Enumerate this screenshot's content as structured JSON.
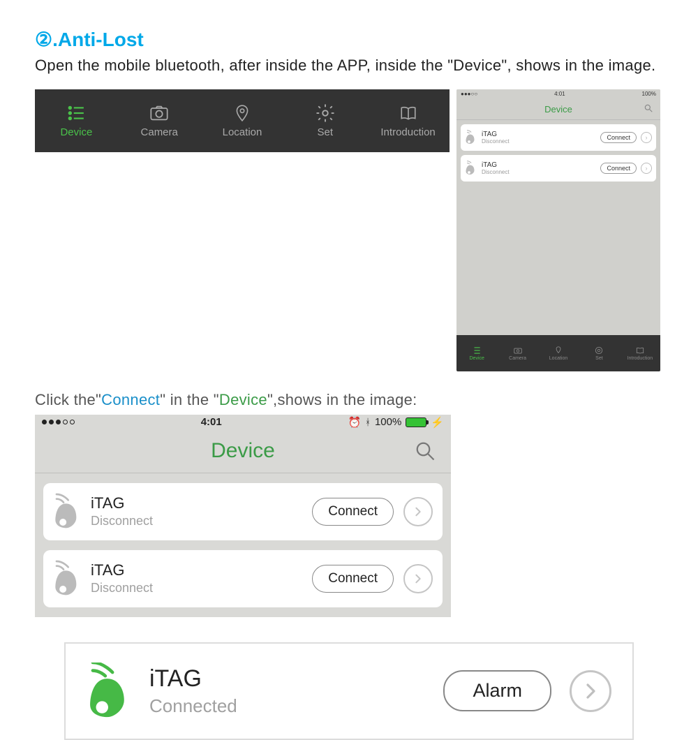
{
  "heading": "②.Anti-Lost",
  "body": "Open the mobile bluetooth, after inside the APP, inside the \"Device\", shows in the image.",
  "toolbar": {
    "items": [
      {
        "label": "Device",
        "icon": "list",
        "active": true
      },
      {
        "label": "Camera",
        "icon": "camera",
        "active": false
      },
      {
        "label": "Location",
        "icon": "pin",
        "active": false
      },
      {
        "label": "Set",
        "icon": "gear",
        "active": false
      },
      {
        "label": "Introduction",
        "icon": "book",
        "active": false
      }
    ]
  },
  "mini_phone": {
    "status_time": "4:01",
    "status_battery": "100%",
    "header_title": "Device",
    "rows": [
      {
        "name": "iTAG",
        "status": "Disconnect",
        "button": "Connect"
      },
      {
        "name": "iTAG",
        "status": "Disconnect",
        "button": "Connect"
      }
    ],
    "nav": [
      {
        "label": "Device",
        "icon": "list",
        "active": true
      },
      {
        "label": "Camera",
        "icon": "camera",
        "active": false
      },
      {
        "label": "Location",
        "icon": "pin",
        "active": false
      },
      {
        "label": "Set",
        "icon": "gear",
        "active": false
      },
      {
        "label": "Introduction",
        "icon": "book",
        "active": false
      }
    ]
  },
  "caption": {
    "p1": "Click the\"",
    "connect": "Connect",
    "p2": "\" in the \"",
    "device": "Device",
    "p3": "\",shows in the image:"
  },
  "big_phone": {
    "status_time": "4:01",
    "status_battery_pct": "100%",
    "header_title": "Device",
    "rows": [
      {
        "name": "iTAG",
        "status": "Disconnect",
        "button": "Connect"
      },
      {
        "name": "iTAG",
        "status": "Disconnect",
        "button": "Connect"
      }
    ]
  },
  "connected": {
    "name": "iTAG",
    "status": "Connected",
    "button": "Alarm"
  },
  "colors": {
    "green": "#4ac24a",
    "grey": "#888"
  }
}
